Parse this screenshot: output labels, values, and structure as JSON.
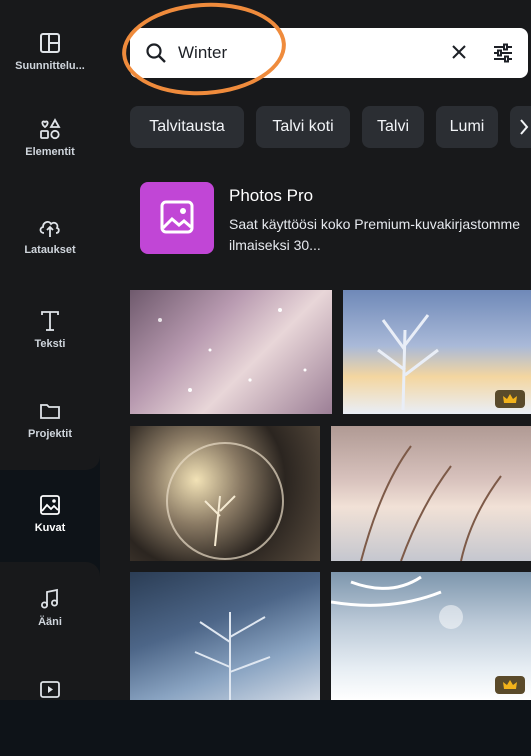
{
  "sidebar": {
    "items": [
      {
        "label": "Suunnittelu...",
        "icon": "layout-icon"
      },
      {
        "label": "Elementit",
        "icon": "elements-icon"
      },
      {
        "label": "Lataukset",
        "icon": "cloud-upload-icon"
      },
      {
        "label": "Teksti",
        "icon": "text-icon"
      },
      {
        "label": "Projektit",
        "icon": "folder-icon"
      },
      {
        "label": "Kuvat",
        "icon": "image-icon",
        "active": true
      },
      {
        "label": "Ääni",
        "icon": "music-note-icon"
      },
      {
        "label": "",
        "icon": "video-icon"
      }
    ]
  },
  "search": {
    "value": "Winter"
  },
  "chips": [
    "Talvitausta",
    "Talvi koti",
    "Talvi",
    "Lumi"
  ],
  "promo": {
    "title": "Photos Pro",
    "description": "Saat käyttöösi koko Premium-kuvakirjastomme ilmaiseksi 30..."
  },
  "colors": {
    "accent": "#c146d6",
    "annotation": "#ef8b3c",
    "premium": "#f2b21b"
  }
}
